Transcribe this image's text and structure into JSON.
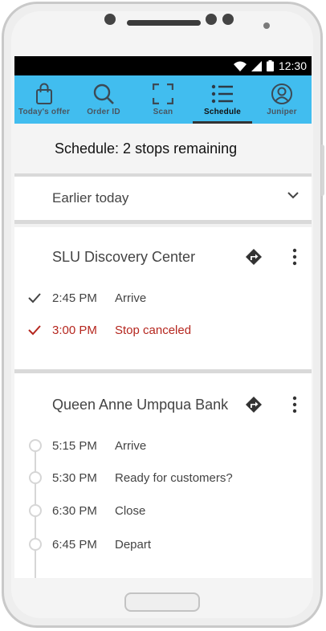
{
  "statusbar": {
    "time": "12:30"
  },
  "tabs": [
    {
      "label": "Today's offer",
      "icon": "shopping-bag-icon"
    },
    {
      "label": "Order ID",
      "icon": "search-icon"
    },
    {
      "label": "Scan",
      "icon": "scan-frame-icon"
    },
    {
      "label": "Schedule",
      "icon": "list-icon",
      "active": true
    },
    {
      "label": "Juniper",
      "icon": "account-icon"
    }
  ],
  "header": {
    "title": "Schedule: 2 stops remaining"
  },
  "earlier": {
    "label": "Earlier today"
  },
  "stops": [
    {
      "name": "SLU Discovery Center",
      "events": [
        {
          "time": "2:45 PM",
          "label": "Arrive",
          "status": "done"
        },
        {
          "time": "3:00 PM",
          "label": "Stop canceled",
          "status": "canceled"
        }
      ]
    },
    {
      "name": "Queen Anne Umpqua Bank",
      "events": [
        {
          "time": "5:15 PM",
          "label": "Arrive",
          "status": "pending"
        },
        {
          "time": "5:30 PM",
          "label": "Ready for customers?",
          "status": "pending"
        },
        {
          "time": "6:30 PM",
          "label": "Close",
          "status": "pending"
        },
        {
          "time": "6:45 PM",
          "label": "Depart",
          "status": "pending"
        }
      ]
    }
  ],
  "colors": {
    "tabbar": "#41bdef",
    "canceled": "#b5261e",
    "divider": "#d9d9d9"
  }
}
